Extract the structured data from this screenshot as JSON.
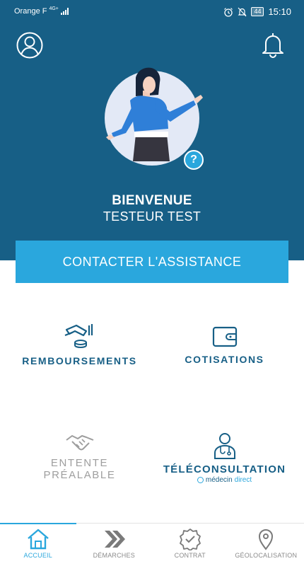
{
  "status_bar": {
    "carrier": "Orange F",
    "network": "4G+",
    "battery": "44",
    "time": "15:10"
  },
  "header": {
    "welcome": "BIENVENUE",
    "user_name": "TESTEUR TEST",
    "help_badge": "?",
    "icons": {
      "profile": "user-circle-icon",
      "notifications": "bell-icon"
    }
  },
  "contact_button": {
    "label": "CONTACTER L'ASSISTANCE"
  },
  "tiles": [
    {
      "label": "REMBOURSEMENTS",
      "icon": "hand-coins-icon"
    },
    {
      "label": "COTISATIONS",
      "icon": "wallet-icon"
    },
    {
      "label_line1": "ENTENTE",
      "label_line2": "PRÉALABLE",
      "icon": "handshake-icon"
    },
    {
      "label": "TÉLÉCONSULTATION",
      "partner_prefix": "médecin",
      "partner_suffix": "direct",
      "icon": "doctor-icon"
    }
  ],
  "bottom_nav": [
    {
      "label": "ACCUEIL",
      "icon": "home-icon",
      "active": true
    },
    {
      "label": "DÉMARCHES",
      "icon": "double-chevron-icon",
      "active": false
    },
    {
      "label": "CONTRAT",
      "icon": "badge-check-icon",
      "active": false
    },
    {
      "label": "GÉOLOCALISATION",
      "icon": "map-pin-icon",
      "active": false
    }
  ],
  "colors": {
    "primary": "#175f86",
    "accent": "#2aa7dd",
    "muted": "#9e9e9e",
    "background": "#ffffff"
  }
}
